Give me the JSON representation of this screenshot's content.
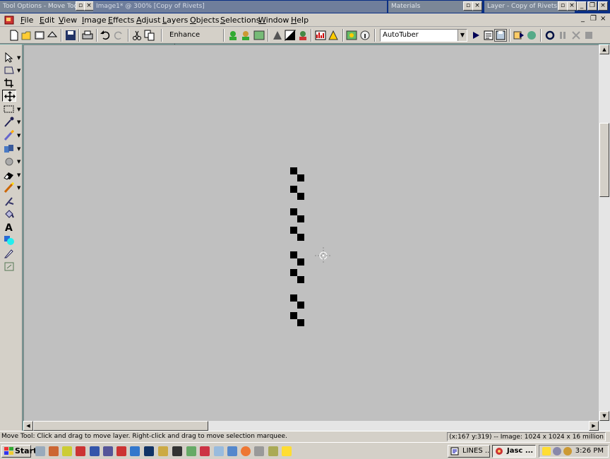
{
  "titlebar": {
    "tool_options": "Tool Options - Move Tool",
    "image_title": "Image1* @ 300% [Copy of Rivets]",
    "materials": "Materials",
    "layer": "Layer - Copy of Rivets"
  },
  "menu": [
    "File",
    "Edit",
    "View",
    "Image",
    "Effects",
    "Adjust",
    "Layers",
    "Objects",
    "Selections",
    "Window",
    "Help"
  ],
  "toolbar": {
    "enhance_photo": "Enhance Photo",
    "autotuber": "AutoTuber"
  },
  "status": {
    "message": "Move Tool: Click and drag to move layer. Right-click and drag to move selection marquee.",
    "info": "(x:167 y:319) -- Image:  1024 x 1024 x 16 million"
  },
  "taskbar": {
    "start": "Start",
    "tasks": [
      "LINES ...",
      "Jasc ..."
    ],
    "clock": "3:26 PM"
  },
  "icons": {
    "tools": [
      "pointer-icon",
      "preset-shape-icon",
      "crop-icon",
      "move-icon",
      "selection-icon",
      "dropper-icon",
      "paint-brush-icon",
      "clone-brush-icon",
      "dodge-icon",
      "eraser-icon",
      "picture-tube-icon",
      "warp-brush-icon",
      "flood-fill-icon",
      "text-icon",
      "preset-shapes-icon",
      "pen-icon",
      "object-selector-icon"
    ]
  },
  "colors": {
    "canvas": "#c0c0c0",
    "chrome": "#d4d0c8",
    "desktop": "#6fa9a5",
    "title_active": "#0a2f84"
  }
}
